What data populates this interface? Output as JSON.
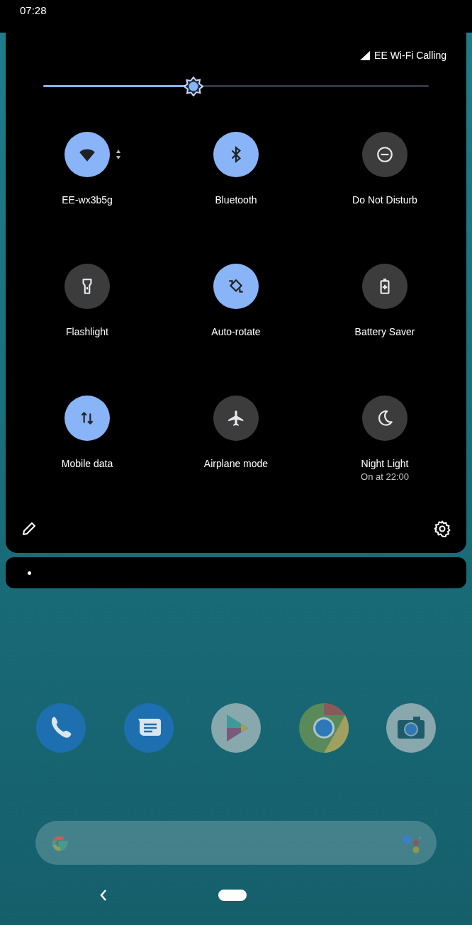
{
  "status_bar": {
    "time": "07:28"
  },
  "carrier": {
    "label": "EE Wi-Fi Calling"
  },
  "brightness": {
    "level": 0.39
  },
  "tiles": [
    {
      "kind": "wifi",
      "label": "EE-wx3b5g",
      "on": true,
      "expandable": true
    },
    {
      "kind": "bluetooth",
      "label": "Bluetooth",
      "on": true,
      "expandable": false
    },
    {
      "kind": "dnd",
      "label": "Do Not Disturb",
      "on": false,
      "expandable": false
    },
    {
      "kind": "flashlight",
      "label": "Flashlight",
      "on": false,
      "expandable": false
    },
    {
      "kind": "rotate",
      "label": "Auto-rotate",
      "on": true,
      "expandable": false
    },
    {
      "kind": "battery",
      "label": "Battery Saver",
      "on": false,
      "expandable": false
    },
    {
      "kind": "data",
      "label": "Mobile data",
      "on": true,
      "expandable": false
    },
    {
      "kind": "airplane",
      "label": "Airplane mode",
      "on": false,
      "expandable": false
    },
    {
      "kind": "night",
      "label": "Night Light",
      "secondary": "On at 22:00",
      "on": false,
      "expandable": false
    }
  ],
  "dock": [
    {
      "kind": "phone"
    },
    {
      "kind": "messages"
    },
    {
      "kind": "play"
    },
    {
      "kind": "browser"
    },
    {
      "kind": "camera"
    }
  ]
}
